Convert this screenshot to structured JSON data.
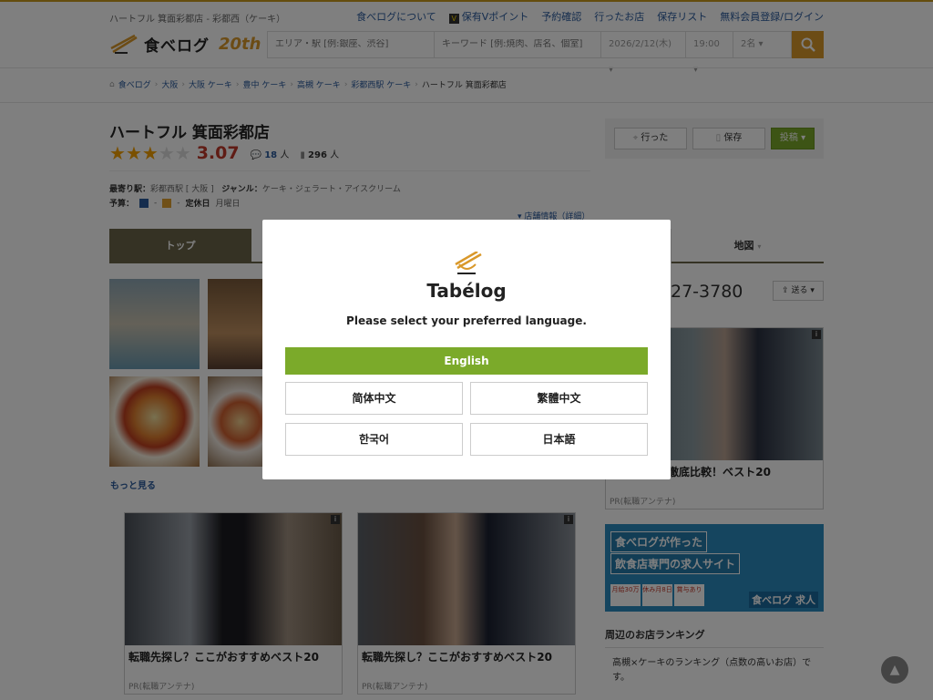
{
  "header": {
    "tagline": "ハートフル 箕面彩都店 - 彩都西（ケーキ）",
    "links": [
      "食べログについて",
      "保有Vポイント",
      "予約確認",
      "行ったお店",
      "保存リスト",
      "無料会員登録/ログイン"
    ],
    "logo_text": "食べログ",
    "anniversary": "20th",
    "search": {
      "area_placeholder": "エリア・駅 [例:銀座、渋谷]",
      "keyword_placeholder": "キーワード [例:焼肉、店名、個室]",
      "date": "2026/2/12(木)",
      "time": "19:00",
      "people": "2名"
    }
  },
  "breadcrumb": [
    "食べログ",
    "大阪",
    "大阪 ケーキ",
    "豊中 ケーキ",
    "高槻 ケーキ",
    "彩都西駅 ケーキ",
    "ハートフル 箕面彩都店"
  ],
  "restaurant": {
    "name": "ハートフル 箕面彩都店",
    "rating": "3.07",
    "rating_stars": 3,
    "reviews": "18",
    "reviews_unit": "人",
    "saves": "296",
    "saves_unit": "人",
    "station_label": "最寄り駅：",
    "station": "彩都西駅",
    "area": "[ 大阪 ]",
    "genre_label": "ジャンル：",
    "genre": "ケーキ・ジェラート・アイスクリーム",
    "budget_label": "予算：",
    "holiday_label": "定休日",
    "holiday": "月曜日",
    "detail_link": "店舗情報（詳細）",
    "phone": "27-3780"
  },
  "actions": {
    "visited": "行った",
    "save": "保存",
    "post": "投稿"
  },
  "tabs": {
    "top": "トップ",
    "map": "地図"
  },
  "photos": {
    "more": "もっと見る"
  },
  "share_label": "送る",
  "ads": [
    {
      "title": "徹底比較！ベスト20",
      "pr": "PR(転職アンテナ)"
    },
    {
      "title": "転職先探し？ここがおすすめベスト20",
      "pr": "PR(転職アンテナ)"
    },
    {
      "title": "転職先探し？ここがおすすめベスト20",
      "pr": "PR(転職アンテナ)"
    }
  ],
  "job_ad": {
    "line1": "食べログが作った",
    "line2": "飲食店専門の求人サイト",
    "badges": [
      "月給30万",
      "休み月8日",
      "賞与あり"
    ],
    "brand": "食べログ 求人"
  },
  "ranking": {
    "heading": "周辺のお店ランキング",
    "text": "高槻×ケーキのランキング（点数の高いお店）です。"
  },
  "modal": {
    "logo": "Tabélog",
    "prompt": "Please select your preferred language.",
    "english": "English",
    "simplified_chinese": "简体中文",
    "traditional_chinese": "繁體中文",
    "korean": "한국어",
    "japanese": "日本語"
  }
}
